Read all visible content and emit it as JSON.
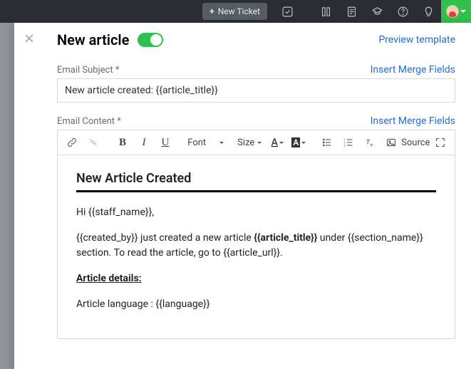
{
  "topbar": {
    "new_ticket": "New Ticket"
  },
  "page": {
    "title": "New article",
    "preview_link": "Preview template"
  },
  "subject": {
    "label": "Email Subject *",
    "value": "New article created: {{article_title}}",
    "merge": "Insert Merge Fields"
  },
  "content": {
    "label": "Email Content *",
    "merge": "Insert Merge Fields"
  },
  "toolbar": {
    "font": "Font",
    "size": "Size",
    "source": "Source"
  },
  "body": {
    "heading": "New Article Created",
    "p1a": "Hi ",
    "p1b": "{{staff_name}},",
    "p2a": "{{created_by}} just created a new article ",
    "p2bold": "{{article_title}}",
    "p2b": " under {{section_name}} section. To read the article, go to {{article_url}}.",
    "p3": "Article details:",
    "p4": "Article language : {{language}}"
  }
}
